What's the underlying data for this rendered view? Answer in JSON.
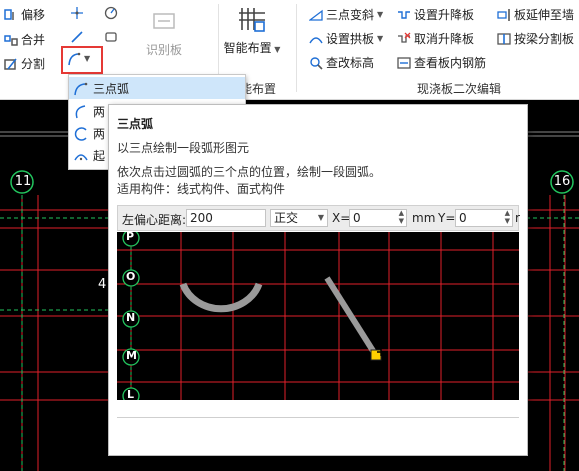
{
  "ribbon": {
    "col1": [
      "偏移",
      "合并",
      "分割"
    ],
    "identify_board": "识别板",
    "smart_layout": "智能布置",
    "smart_layout_group": "智能布置",
    "cast_slab_group": "现浇板二次编辑",
    "col_a": [
      "三点变斜",
      "设置拱板",
      "查改标高"
    ],
    "col_b": [
      "设置升降板",
      "取消升降板",
      "查看板内钢筋"
    ],
    "col_c": [
      "板延伸至墙",
      "按梁分割板"
    ]
  },
  "dropdown": {
    "items": [
      "三点弧",
      "两",
      "两",
      "起"
    ]
  },
  "tooltip": {
    "title": "三点弧",
    "desc": "以三点绘制一段弧形图元",
    "line1": "依次点击过圆弧的三个点的位置，绘制一段圆弧。",
    "line2": "适用构件：线式构件、面式构件",
    "offset_label": "左偏心距离:",
    "offset_value": "200",
    "mode_value": "正交",
    "x_label": "X=",
    "x_value": "0",
    "mm_label": "mm",
    "y_label": "Y=",
    "y_value": "0",
    "trail": "r"
  },
  "canvas": {
    "axis_labels": [
      "11",
      "16",
      "4"
    ],
    "preview_axes": [
      "P",
      "O",
      "N",
      "M",
      "L"
    ]
  },
  "colors": {
    "grid": "#e0202a",
    "axis": "#22c55e",
    "accent": "#1f6fd6",
    "highlight_box": "#e53935"
  }
}
